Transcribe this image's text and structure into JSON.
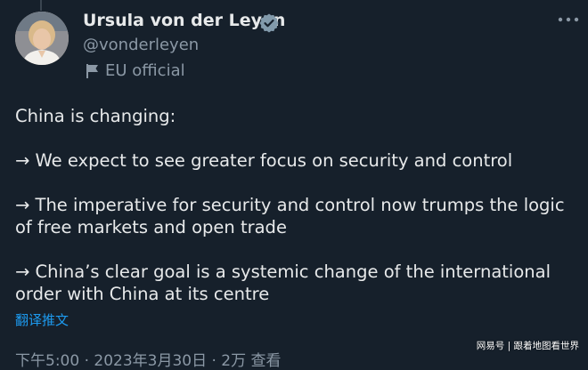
{
  "author": {
    "display_name": "Ursula von der Leyen",
    "handle": "@vonderleyen",
    "affiliation": "EU official",
    "verified_icon": "verified-badge-icon",
    "affiliation_icon": "flag-icon"
  },
  "tweet": {
    "paragraphs": [
      "China is changing:",
      "→ We expect to see greater focus on security and control",
      "→ The imperative for security and control now trumps the logic of free markets and open trade",
      "→ China’s clear goal is a systemic change of the international order with China at its centre"
    ],
    "translate_label": "翻译推文",
    "timestamp": "下午5:00 · 2023年3月30日 · 2万 查看"
  },
  "watermark": "网易号 | 跟着地图看世界",
  "colors": {
    "background": "#16202b",
    "text": "#e7e9ea",
    "muted": "#8b98a5",
    "accent": "#1d9bf0"
  }
}
